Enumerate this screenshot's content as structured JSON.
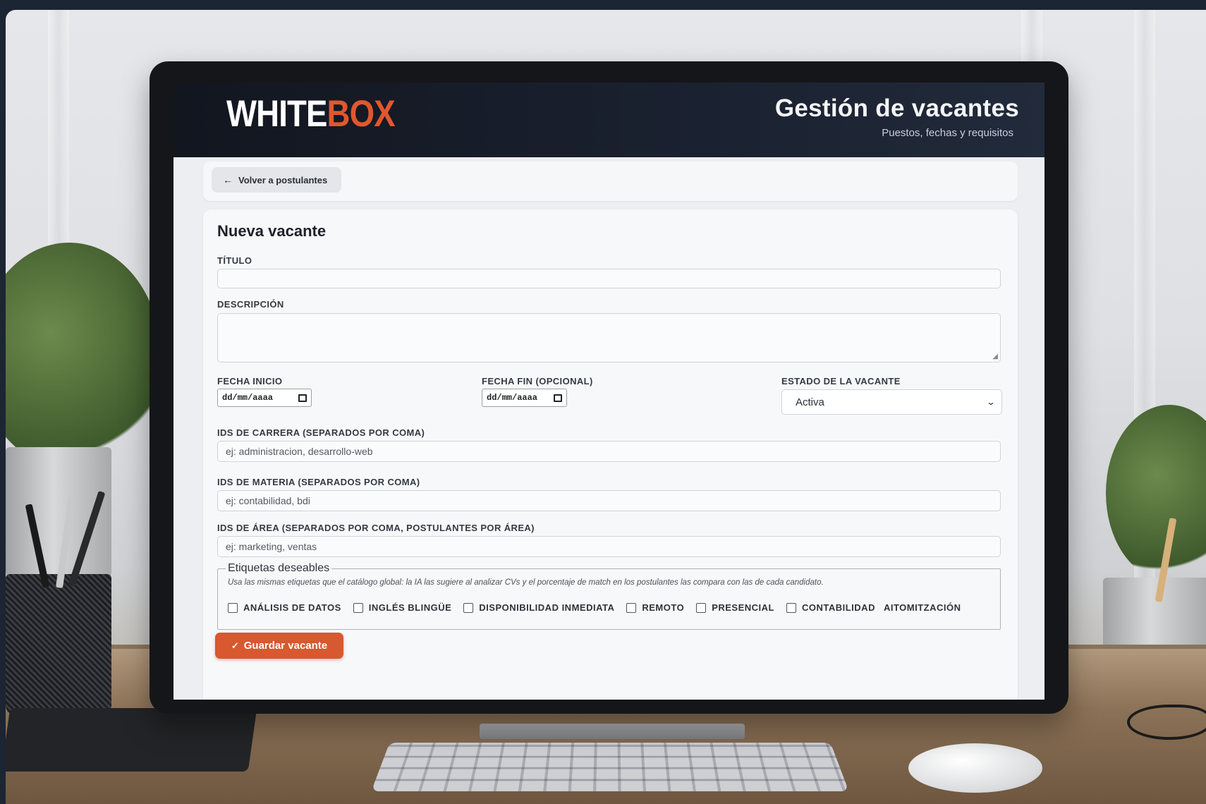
{
  "brand": {
    "logo_main": "WHITE",
    "logo_accent": "BOX",
    "accent_color": "#e1572d"
  },
  "header": {
    "title": "Gestión de vacantes",
    "subtitle": "Puestos, fechas y requisitos"
  },
  "nav": {
    "back_label": "Volver a postulantes",
    "back_icon": "arrow-left-icon"
  },
  "form": {
    "title": "Nueva vacante",
    "titulo": {
      "label": "TÍTULO",
      "value": "",
      "placeholder": ""
    },
    "descripcion": {
      "label": "DESCRIPCIÓN",
      "value": ""
    },
    "fecha_inicio": {
      "label": "FECHA INICIO",
      "value": "dd/mm/aaaa"
    },
    "fecha_fin": {
      "label": "FECHA FIN (OPCIONAL)",
      "value": "dd/mm/aaaa"
    },
    "estado": {
      "label": "ESTADO DE LA VACANTE",
      "selected": "Activa"
    },
    "carrera": {
      "label": "IDS DE CARRERA (SEPARADOS POR COMA)",
      "placeholder": "ej: administracion, desarrollo-web"
    },
    "materia": {
      "label": "IDS DE MATERIA (SEPARADOS POR COMA)",
      "placeholder": "ej: contabilidad, bdi"
    },
    "area": {
      "label": "IDS DE ÁREA (SEPARADOS POR COMA, POSTULANTES POR ÁREA)",
      "placeholder": "ej: marketing, ventas"
    },
    "etiquetas": {
      "legend": "Etiquetas deseables",
      "hint": "Usa las mismas etiquetas que el catálogo global: la IA las sugiere al analizar CVs y el porcentaje de match en los postulantes las compara con las de cada candidato.",
      "options": [
        {
          "label": "ANÁLISIS DE DATOS",
          "checked": false
        },
        {
          "label": "INGLÉS BLINGÜE",
          "checked": false
        },
        {
          "label": "DISPONIBILIDAD INMEDIATA",
          "checked": false
        },
        {
          "label": "REMOTO",
          "checked": false
        },
        {
          "label": "PRESENCIAL",
          "checked": false
        },
        {
          "label": "CONTABILIDAD",
          "checked": false
        }
      ],
      "trailing_label": "AITOMITZACIÓN"
    },
    "save_label": "Guardar vacante"
  }
}
